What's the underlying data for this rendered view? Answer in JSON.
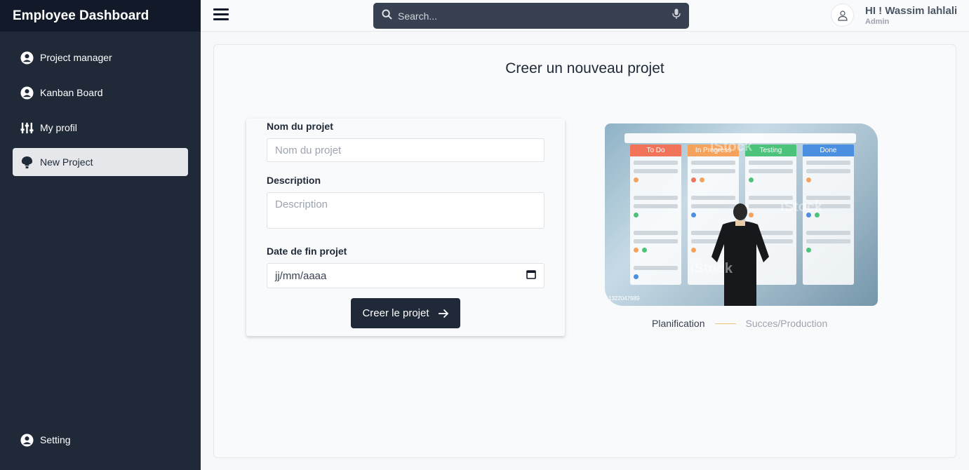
{
  "app": {
    "title": "Employee Dashboard"
  },
  "sidebar": {
    "items": [
      {
        "label": "Project manager",
        "icon": "user-circle-icon"
      },
      {
        "label": "Kanban Board",
        "icon": "user-circle-icon"
      },
      {
        "label": "My profil",
        "icon": "sliders-icon"
      },
      {
        "label": "New Project",
        "icon": "bulb-icon",
        "active": true
      }
    ],
    "bottom": {
      "label": "Setting",
      "icon": "user-circle-icon"
    }
  },
  "header": {
    "search_placeholder": "Search...",
    "greeting": "HI ! Wassim lahlali",
    "role": "Admin"
  },
  "main": {
    "title": "Creer un nouveau projet",
    "form": {
      "name_label": "Nom du projet",
      "name_placeholder": "Nom du projet",
      "description_label": "Description",
      "description_placeholder": "Description",
      "date_label": "Date de fin projet",
      "date_placeholder": "jj/mm/aaaa",
      "submit_label": "Creer le projet"
    },
    "illustration": {
      "columns": [
        "To Do",
        "In Progress",
        "Testing",
        "Done"
      ],
      "column_colors": [
        "#f0735a",
        "#f5a35c",
        "#4cc27a",
        "#4b8fe0"
      ],
      "watermark": "iStock",
      "image_id": "1322047989"
    },
    "legend": {
      "from": "Planification",
      "to": "Succes/Production"
    }
  },
  "colors": {
    "sidebar": "#1f2937",
    "brand_bar": "#121a2a",
    "accent": "#1f2937"
  }
}
